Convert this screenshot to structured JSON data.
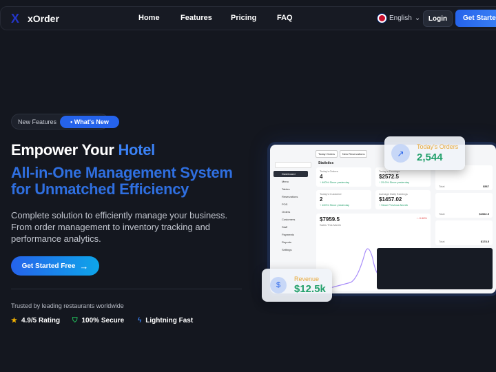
{
  "nav": {
    "logo": "X",
    "brand": "xOrder",
    "links": [
      "Home",
      "Features",
      "Pricing",
      "FAQ"
    ],
    "language": "English",
    "login": "Login",
    "get_started": "Get Started"
  },
  "hero": {
    "badge_left": "New Features",
    "badge_right": "What's New",
    "title_prefix": "Empower Your ",
    "title_highlight": "Hotel",
    "subtitle_line1": "All-in-One Management System",
    "subtitle_line2": "for Unmatched Efficiency",
    "description": "Complete solution to efficiently manage your business. From order management to inventory tracking and performance analytics.",
    "cta": "Get Started Free",
    "trusted": "Trusted by leading restaurants worldwide",
    "features": [
      {
        "icon": "star-icon",
        "label": "4.9/5 Rating"
      },
      {
        "icon": "shield-check-icon",
        "label": "100% Secure"
      },
      {
        "icon": "lightning-icon",
        "label": "Lightning Fast"
      }
    ]
  },
  "colors": {
    "accent": "#2563eb",
    "green": "#22a06b",
    "orange": "#e8a93a"
  },
  "mockup": {
    "top_buttons": [
      "Today Orders",
      "New Reservations"
    ],
    "section": "Statistics",
    "sidebar": [
      "Dashboard",
      "Menu",
      "Tables",
      "Reservations",
      "POS",
      "Orders",
      "Customers",
      "Staff",
      "Payments",
      "Reports",
      "Settings"
    ],
    "stats": [
      {
        "label": "Today's Orders",
        "value": "4",
        "change": "↑ 400% Since yesterday"
      },
      {
        "label": "Today's Earnings",
        "value": "$2572.5",
        "change": "↑ 25.0% Since yesterday"
      },
      {
        "label": "Today's Customer",
        "value": "2",
        "change": "↑ 100% Since yesterday"
      },
      {
        "label": "Average Daily Earnings",
        "value": "$1457.02",
        "change": "↑ Since Previous Month"
      }
    ],
    "chart": {
      "value": "$7959.5",
      "label": "Sales This Month",
      "change": "↓ -3.68%"
    },
    "orders_totals": [
      "$567",
      "$1522.5",
      "$178.5"
    ],
    "orders_label": "Total"
  },
  "floats": {
    "orders_label": "Today's Orders",
    "orders_value": "2,544",
    "revenue_label": "Revenue",
    "revenue_value": "$12.5k"
  }
}
